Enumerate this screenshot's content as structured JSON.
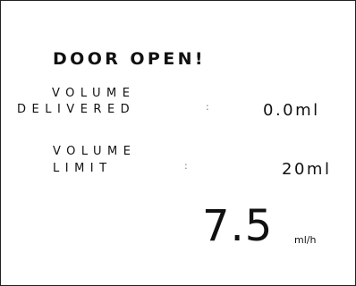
{
  "alarm": {
    "message": "DOOR OPEN!"
  },
  "volume_delivered": {
    "label_line1": "VOLUME",
    "label_line2": "DELIVERED",
    "separator": ":",
    "value": "0.0ml"
  },
  "volume_limit": {
    "label_line1": "VOLUME",
    "label_line2": "LIMIT",
    "separator": ":",
    "value": "20ml"
  },
  "rate": {
    "value": "7.5",
    "unit": "ml/h"
  }
}
